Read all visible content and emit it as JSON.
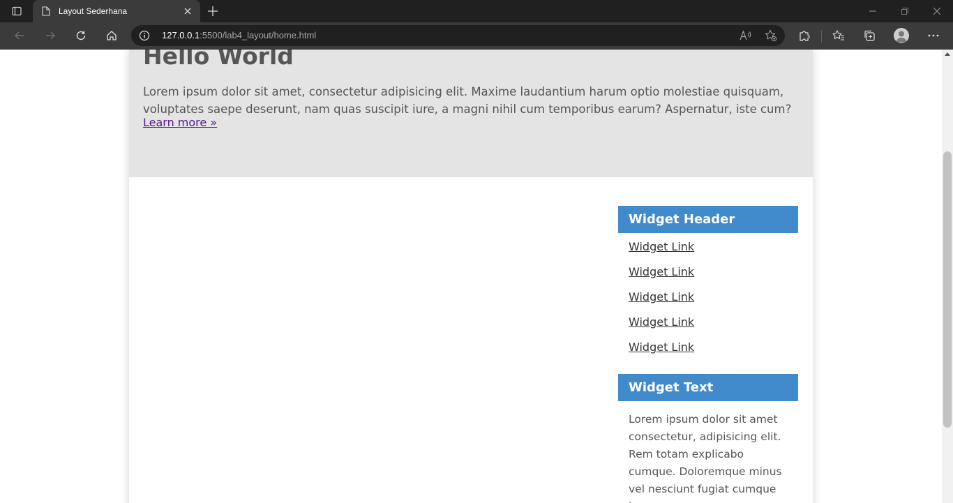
{
  "browser": {
    "tab_title": "Layout Sederhana",
    "address_host": "127.0.0.1",
    "address_rest": ":5500/lab4_layout/home.html"
  },
  "hero": {
    "title": "Hello World",
    "text": "Lorem ipsum dolor sit amet, consectetur adipisicing elit. Maxime laudantium harum optio molestiae quisquam, voluptates saepe deserunt, nam quas suscipit iure, a magni nihil cum temporibus earum? Aspernatur, iste cum?",
    "link": "Learn more »"
  },
  "sidebar": {
    "links_header": "Widget Header",
    "links": [
      "Widget Link",
      "Widget Link",
      "Widget Link",
      "Widget Link",
      "Widget Link"
    ],
    "text_header": "Widget Text",
    "text": "Lorem ipsum dolor sit amet consectetur, adipisicing elit. Rem totam explicabo cumque. Doloremque minus vel nesciunt fugiat cumque ipsam"
  },
  "colors": {
    "widget_header": "#418acb",
    "hero_background": "#e4e4e4",
    "visited_link": "#551a8b"
  }
}
